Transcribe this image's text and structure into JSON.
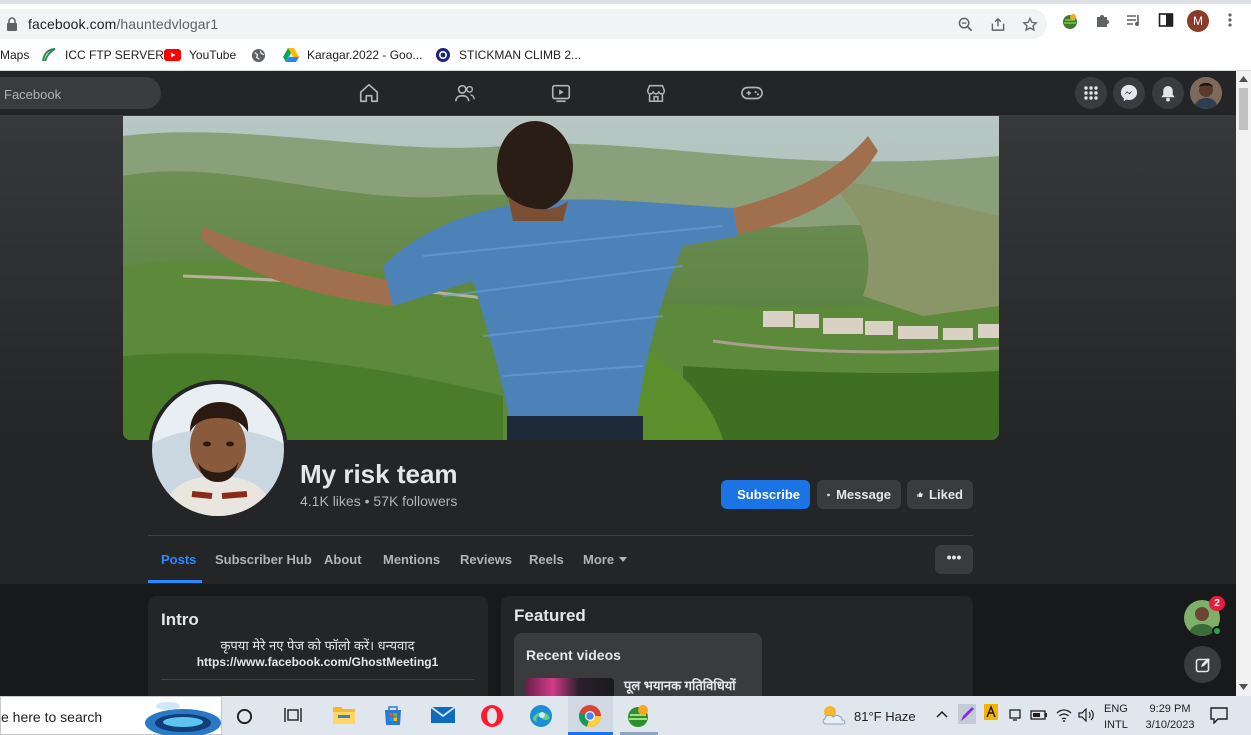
{
  "browser": {
    "url_host": "facebook.com",
    "url_path": "/hauntedvlogar1",
    "profile_initial": "M",
    "bookmarks": [
      {
        "label": "Maps"
      },
      {
        "label": "ICC FTP SERVER"
      },
      {
        "label": "YouTube"
      },
      {
        "label": ""
      },
      {
        "label": "Karagar.2022 - Goo..."
      },
      {
        "label": "STICKMAN CLIMB 2..."
      }
    ]
  },
  "fb_nav": {
    "search_placeholder": "Facebook"
  },
  "page": {
    "name": "My risk team",
    "stats": "4.1K likes • 57K followers",
    "subscribe_label": "Subscribe",
    "message_label": "Message",
    "liked_label": "Liked",
    "tabs": [
      {
        "label": "Posts",
        "active": true
      },
      {
        "label": "Subscriber Hub"
      },
      {
        "label": "About"
      },
      {
        "label": "Mentions"
      },
      {
        "label": "Reviews"
      },
      {
        "label": "Reels"
      },
      {
        "label": "More"
      }
    ],
    "more_button": "•••",
    "intro": {
      "title": "Intro",
      "text": "कृपया मेरे नए पेज को फॉलो करें। धन्यवाद",
      "link": "https://www.facebook.com/GhostMeeting1"
    },
    "featured": {
      "title": "Featured",
      "recent_videos_title": "Recent videos",
      "video_title": "पूल भयानक गतिविधियों"
    },
    "chat_badge": "2"
  },
  "taskbar": {
    "search_text": "e here to search",
    "weather": "81°F  Haze",
    "lang_line1": "ENG",
    "lang_line2": "INTL",
    "time": "9:29 PM",
    "date": "3/10/2023"
  },
  "colors": {
    "fb_blue": "#2d88ff",
    "subscribe_bg": "#1b74e4",
    "nav_bg": "#242526",
    "page_bg": "#18191a"
  }
}
